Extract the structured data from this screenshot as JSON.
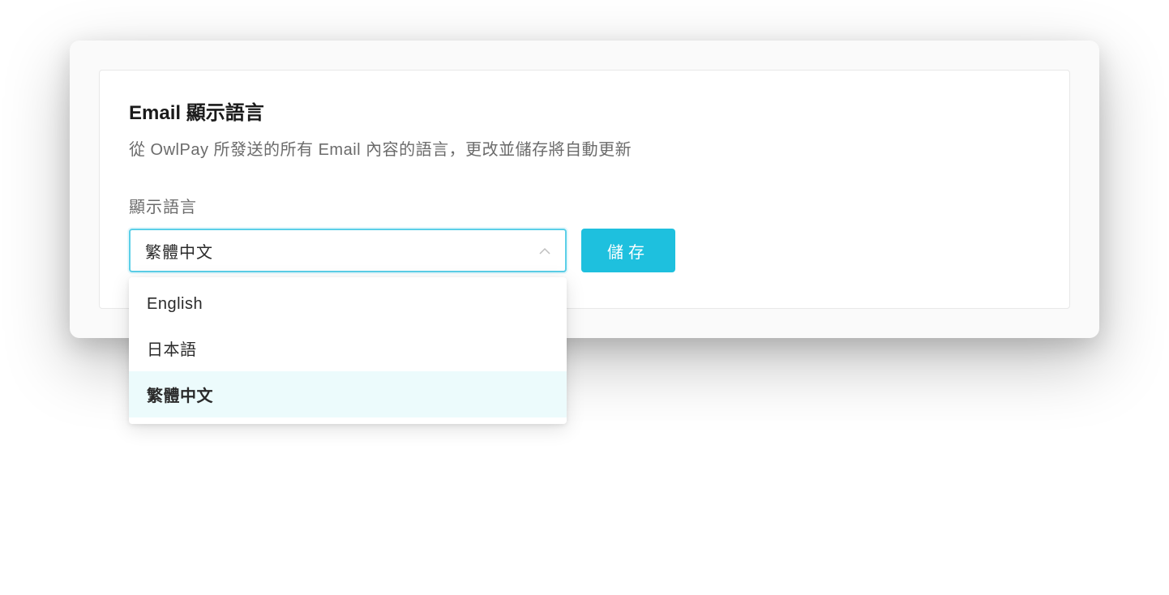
{
  "card": {
    "title": "Email 顯示語言",
    "description": "從 OwlPay 所發送的所有 Email 內容的語言，更改並儲存將自動更新"
  },
  "form": {
    "field_label": "顯示語言",
    "selected_value": "繁體中文",
    "save_label": "儲存",
    "options": [
      {
        "label": "English",
        "selected": false
      },
      {
        "label": "日本語",
        "selected": false
      },
      {
        "label": "繁體中文",
        "selected": true
      }
    ]
  },
  "colors": {
    "accent": "#1ec0de",
    "select_border": "#5bcfe8",
    "option_selected_bg": "#ecfbfc"
  }
}
